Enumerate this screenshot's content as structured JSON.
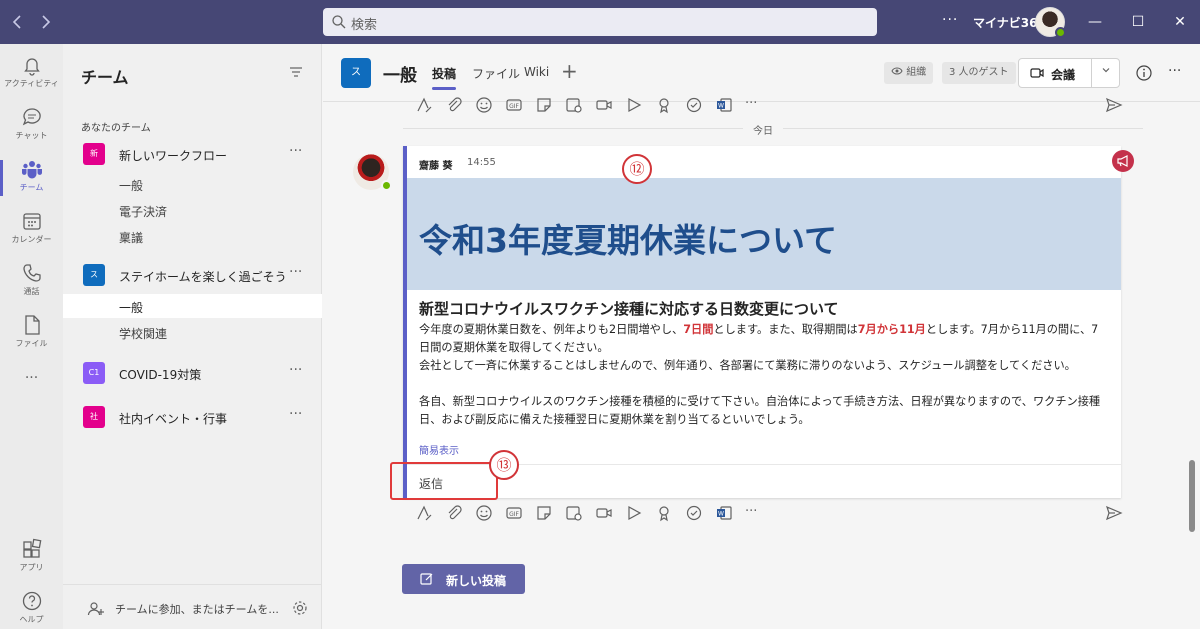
{
  "titlebar": {
    "back_icon": "chevron-left-icon",
    "forward_icon": "chevron-right-icon",
    "search_placeholder": "検索",
    "more_label": "···",
    "org_name": "マイナビ365",
    "minimize": "—",
    "maximize": "☐",
    "close": "✕"
  },
  "rail": {
    "items": [
      {
        "label": "アクティビティ",
        "icon": "bell-icon"
      },
      {
        "label": "チャット",
        "icon": "chat-icon"
      },
      {
        "label": "チーム",
        "icon": "teams-icon"
      },
      {
        "label": "カレンダー",
        "icon": "calendar-icon"
      },
      {
        "label": "通話",
        "icon": "phone-icon"
      },
      {
        "label": "ファイル",
        "icon": "file-icon"
      }
    ],
    "more_label": "···",
    "apps_label": "アプリ",
    "help_label": "ヘルプ"
  },
  "teams_panel": {
    "title": "チーム",
    "section_label": "あなたのチーム",
    "teams": [
      {
        "tile": "新",
        "tile_color": "#e3008c",
        "name": "新しいワークフロー",
        "channels": [
          "一般",
          "電子決済",
          "稟議"
        ]
      },
      {
        "tile": "ス",
        "tile_color": "#0f6cbd",
        "name": "ステイホームを楽しく過ごそう",
        "channels": [
          "一般",
          "学校関連"
        ]
      },
      {
        "tile": "C1",
        "tile_color": "#8b5cf6",
        "name": "COVID-19対策",
        "channels": []
      },
      {
        "tile": "社",
        "tile_color": "#e3008c",
        "name": "社内イベント・行事",
        "channels": []
      }
    ],
    "team_more": "···",
    "footer_label": "チームに参加、またはチームを..."
  },
  "channel_header": {
    "avatar": "ス",
    "name": "一般",
    "tabs": [
      "投稿",
      "ファイル",
      "Wiki"
    ],
    "add_tab": "+",
    "org_chip": "組織",
    "guests_chip": "3 人のゲスト",
    "meet_label": "会議",
    "more": "···"
  },
  "feed": {
    "day_label": "今日",
    "post": {
      "author": "齋藤 葵",
      "time": "14:55",
      "banner_title": "令和3年度夏期休業について",
      "subject": "新型コロナウイルスワクチン接種に対応する日数変更について",
      "p1_a": "今年度の夏期休業日数を、例年よりも2日間増やし、",
      "p1_red1": "7日間",
      "p1_b": "とします。また、取得期間は",
      "p1_red2": "7月から11月",
      "p1_c": "とします。7月から11月の間に、7日間の夏期休業を取得してください。",
      "p1_d": "会社として一斉に休業することはしませんので、例年通り、各部署にて業務に滞りのないよう、スケジュール調整をしてください。",
      "p2": "各自、新型コロナウイルスのワクチン接種を積極的に受けて下さい。自治体によって手続き方法、日程が異なりますので、ワクチン接種日、および副反応に備えた接種翌日に夏期休業を割り当てるといいでしょう。",
      "collapse": "簡易表示",
      "reply": "返信"
    },
    "callout_12": "⑫",
    "callout_13": "⑬",
    "new_post": "新しい投稿",
    "more_tool": "···"
  },
  "colors": {
    "titlebar": "#464775",
    "accent": "#5b5fc7",
    "banner": "#cad9ea",
    "banner_text": "#1f4e8c",
    "highlight": "#d13438"
  }
}
